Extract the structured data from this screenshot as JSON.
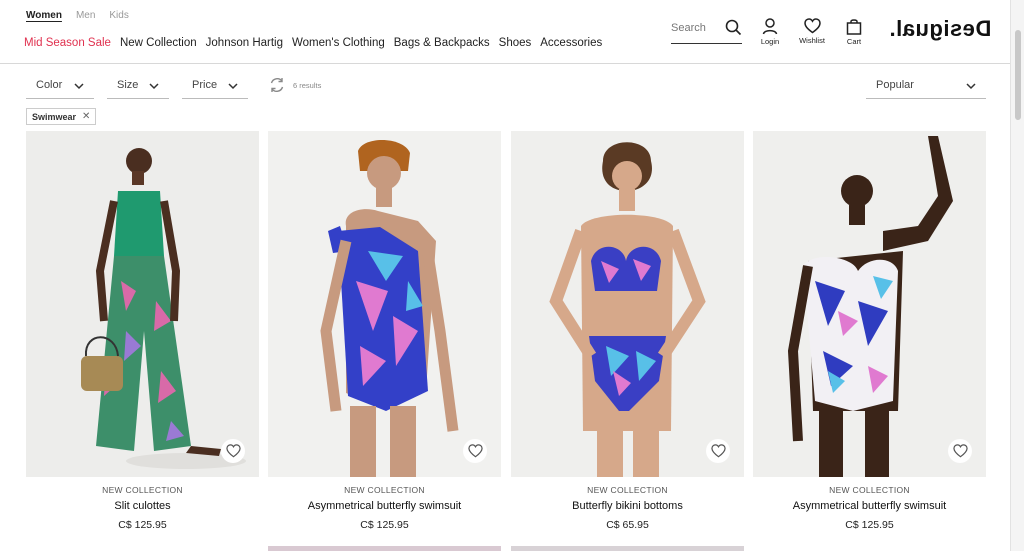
{
  "header": {
    "gender_tabs": [
      "Women",
      "Men",
      "Kids"
    ],
    "nav": [
      "Mid Season Sale",
      "New Collection",
      "Johnson Hartig",
      "Women's Clothing",
      "Bags & Backpacks",
      "Shoes",
      "Accessories"
    ],
    "search_placeholder": "Search",
    "login_label": "Login",
    "wishlist_label": "Wishlist",
    "cart_label": "Cart",
    "logo_text": "Desigual.",
    "sale_color": "#e0314f"
  },
  "filters": {
    "color_label": "Color",
    "size_label": "Size",
    "price_label": "Price",
    "results_text": "6 results",
    "sort_label": "Popular",
    "active_chip": "Swimwear"
  },
  "products": [
    {
      "tag": "NEW COLLECTION",
      "name": "Slit culottes",
      "price": "C$ 125.95"
    },
    {
      "tag": "NEW COLLECTION",
      "name": "Asymmetrical butterfly swimsuit",
      "price": "C$ 125.95"
    },
    {
      "tag": "NEW COLLECTION",
      "name": "Butterfly bikini bottoms",
      "price": "C$ 65.95"
    },
    {
      "tag": "NEW COLLECTION",
      "name": "Asymmetrical butterfly swimsuit",
      "price": "C$ 125.95"
    }
  ],
  "icons": {
    "search": "search-icon",
    "login": "user-icon",
    "wishlist": "heart-icon",
    "cart": "bag-icon",
    "dropdown": "chevron-down-icon",
    "refresh": "refresh-icon",
    "remove": "close-icon"
  }
}
